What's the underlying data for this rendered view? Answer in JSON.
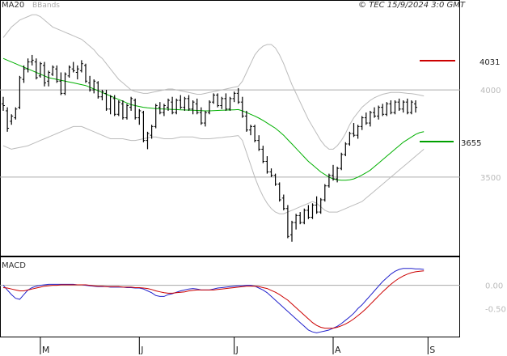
{
  "header": {
    "ma_label": "MA20",
    "bb_label": "BBands",
    "copyright": "© TEC 15/9/2024 3:0 GMT"
  },
  "macd_label": "MACD",
  "levels": {
    "resistance": "4031",
    "resistance_color": "#cc0000",
    "support": "3655",
    "support_color": "#00a000"
  },
  "colors": {
    "price": "#000000",
    "ma": "#00b000",
    "bbands": "#bbbbbb",
    "macd": "#2222cc",
    "signal": "#cc0000",
    "grid": "#aaaaaa"
  },
  "chart_data": [
    {
      "type": "bar",
      "title": "",
      "ylabel": "",
      "ylim": [
        3050,
        4450
      ],
      "ticks": [
        {
          "value": 4000,
          "label": "4000"
        },
        {
          "value": 3500,
          "label": "3500"
        }
      ],
      "gridlines": [
        4000,
        3500
      ],
      "x_labels": [
        {
          "index": 9,
          "label": "M"
        },
        {
          "index": 33,
          "label": "J"
        },
        {
          "index": 56,
          "label": "J"
        },
        {
          "index": 80,
          "label": "A"
        },
        {
          "index": 103,
          "label": "S"
        }
      ],
      "ohlc": [
        [
          3920,
          3960,
          3880,
          3910
        ],
        [
          3880,
          3900,
          3760,
          3780
        ],
        [
          3820,
          3860,
          3800,
          3850
        ],
        [
          3840,
          3900,
          3830,
          3890
        ],
        [
          3900,
          4080,
          3890,
          4070
        ],
        [
          4060,
          4140,
          4040,
          4120
        ],
        [
          4120,
          4180,
          4100,
          4160
        ],
        [
          4160,
          4200,
          4140,
          4170
        ],
        [
          4160,
          4180,
          4060,
          4070
        ],
        [
          4080,
          4160,
          4070,
          4150
        ],
        [
          4140,
          4160,
          4020,
          4040
        ],
        [
          4050,
          4110,
          4020,
          4100
        ],
        [
          4090,
          4140,
          4080,
          4130
        ],
        [
          4120,
          4140,
          4040,
          4050
        ],
        [
          4050,
          4100,
          3970,
          3980
        ],
        [
          3980,
          4100,
          3970,
          4090
        ],
        [
          4080,
          4140,
          4070,
          4130
        ],
        [
          4120,
          4160,
          4100,
          4110
        ],
        [
          4100,
          4140,
          4060,
          4120
        ],
        [
          4110,
          4170,
          4100,
          4150
        ],
        [
          4140,
          4150,
          4040,
          4050
        ],
        [
          4040,
          4080,
          3990,
          4000
        ],
        [
          4000,
          4060,
          3980,
          4050
        ],
        [
          4040,
          4050,
          3950,
          3960
        ],
        [
          3960,
          4000,
          3940,
          3990
        ],
        [
          3980,
          4000,
          3880,
          3890
        ],
        [
          3890,
          3970,
          3860,
          3960
        ],
        [
          3950,
          3970,
          3850,
          3860
        ],
        [
          3860,
          3940,
          3850,
          3930
        ],
        [
          3920,
          3940,
          3830,
          3840
        ],
        [
          3840,
          3920,
          3830,
          3910
        ],
        [
          3900,
          3960,
          3880,
          3950
        ],
        [
          3940,
          3950,
          3830,
          3840
        ],
        [
          3840,
          3890,
          3800,
          3880
        ],
        [
          3870,
          3880,
          3700,
          3710
        ],
        [
          3710,
          3760,
          3660,
          3750
        ],
        [
          3740,
          3800,
          3720,
          3790
        ],
        [
          3790,
          3920,
          3780,
          3910
        ],
        [
          3900,
          3930,
          3860,
          3870
        ],
        [
          3870,
          3920,
          3850,
          3910
        ],
        [
          3900,
          3950,
          3880,
          3940
        ],
        [
          3930,
          3960,
          3860,
          3870
        ],
        [
          3870,
          3950,
          3860,
          3940
        ],
        [
          3940,
          3970,
          3890,
          3900
        ],
        [
          3900,
          3960,
          3880,
          3950
        ],
        [
          3950,
          3970,
          3880,
          3890
        ],
        [
          3890,
          3940,
          3860,
          3930
        ],
        [
          3920,
          3950,
          3860,
          3870
        ],
        [
          3870,
          3900,
          3800,
          3810
        ],
        [
          3810,
          3880,
          3790,
          3870
        ],
        [
          3870,
          3940,
          3860,
          3930
        ],
        [
          3930,
          3980,
          3920,
          3970
        ],
        [
          3970,
          3980,
          3900,
          3910
        ],
        [
          3910,
          3960,
          3890,
          3950
        ],
        [
          3950,
          3980,
          3880,
          3890
        ],
        [
          3890,
          3960,
          3880,
          3950
        ],
        [
          3950,
          3990,
          3930,
          3980
        ],
        [
          3980,
          4010,
          3920,
          3930
        ],
        [
          3930,
          3960,
          3840,
          3850
        ],
        [
          3850,
          3880,
          3760,
          3770
        ],
        [
          3770,
          3800,
          3740,
          3790
        ],
        [
          3790,
          3800,
          3700,
          3710
        ],
        [
          3710,
          3740,
          3650,
          3660
        ],
        [
          3660,
          3680,
          3580,
          3590
        ],
        [
          3590,
          3620,
          3520,
          3530
        ],
        [
          3530,
          3550,
          3500,
          3510
        ],
        [
          3510,
          3520,
          3450,
          3460
        ],
        [
          3460,
          3470,
          3360,
          3370
        ],
        [
          3380,
          3400,
          3310,
          3320
        ],
        [
          3320,
          3340,
          3150,
          3160
        ],
        [
          3170,
          3250,
          3130,
          3240
        ],
        [
          3240,
          3290,
          3200,
          3280
        ],
        [
          3280,
          3300,
          3230,
          3240
        ],
        [
          3240,
          3320,
          3230,
          3310
        ],
        [
          3310,
          3340,
          3260,
          3270
        ],
        [
          3270,
          3350,
          3260,
          3340
        ],
        [
          3340,
          3390,
          3290,
          3300
        ],
        [
          3300,
          3380,
          3290,
          3370
        ],
        [
          3370,
          3460,
          3360,
          3450
        ],
        [
          3450,
          3520,
          3440,
          3510
        ],
        [
          3510,
          3570,
          3480,
          3490
        ],
        [
          3490,
          3560,
          3470,
          3550
        ],
        [
          3550,
          3640,
          3540,
          3630
        ],
        [
          3630,
          3700,
          3620,
          3690
        ],
        [
          3690,
          3760,
          3680,
          3750
        ],
        [
          3750,
          3810,
          3730,
          3740
        ],
        [
          3740,
          3800,
          3720,
          3790
        ],
        [
          3790,
          3850,
          3770,
          3840
        ],
        [
          3840,
          3870,
          3800,
          3810
        ],
        [
          3810,
          3880,
          3790,
          3870
        ],
        [
          3870,
          3900,
          3840,
          3850
        ],
        [
          3850,
          3910,
          3830,
          3900
        ],
        [
          3900,
          3920,
          3850,
          3860
        ],
        [
          3860,
          3930,
          3850,
          3920
        ],
        [
          3920,
          3940,
          3860,
          3870
        ],
        [
          3870,
          3940,
          3860,
          3930
        ],
        [
          3930,
          3950,
          3880,
          3890
        ],
        [
          3890,
          3940,
          3870,
          3930
        ],
        [
          3930,
          3950,
          3860,
          3870
        ],
        [
          3870,
          3940,
          3860,
          3930
        ],
        [
          3920,
          3940,
          3870,
          3900
        ]
      ],
      "ma20": [
        4180,
        4170,
        4160,
        4150,
        4140,
        4130,
        4120,
        4110,
        4100,
        4090,
        4080,
        4070,
        4065,
        4060,
        4055,
        4050,
        4045,
        4040,
        4035,
        4030,
        4025,
        4015,
        4005,
        3995,
        3985,
        3975,
        3965,
        3955,
        3945,
        3935,
        3925,
        3915,
        3910,
        3905,
        3900,
        3897,
        3895,
        3893,
        3891,
        3890,
        3889,
        3888,
        3887,
        3886,
        3885,
        3884,
        3883,
        3882,
        3881,
        3880,
        3880,
        3881,
        3882,
        3883,
        3884,
        3885,
        3886,
        3887,
        3880,
        3870,
        3860,
        3850,
        3838,
        3825,
        3810,
        3795,
        3780,
        3760,
        3740,
        3715,
        3690,
        3665,
        3640,
        3615,
        3590,
        3570,
        3550,
        3530,
        3515,
        3500,
        3490,
        3485,
        3482,
        3482,
        3485,
        3490,
        3500,
        3512,
        3525,
        3540,
        3560,
        3580,
        3600,
        3620,
        3640,
        3660,
        3680,
        3700,
        3715,
        3730,
        3745,
        3755,
        3760
      ],
      "bb_upper": [
        4300,
        4330,
        4360,
        4380,
        4400,
        4410,
        4420,
        4430,
        4430,
        4420,
        4400,
        4380,
        4360,
        4350,
        4340,
        4330,
        4320,
        4310,
        4300,
        4290,
        4270,
        4250,
        4230,
        4200,
        4180,
        4150,
        4120,
        4090,
        4060,
        4040,
        4020,
        4000,
        3990,
        3985,
        3980,
        3980,
        3985,
        3990,
        3995,
        4000,
        4005,
        4005,
        4000,
        3995,
        3990,
        3985,
        3980,
        3975,
        3975,
        3980,
        3985,
        3990,
        3995,
        4000,
        4005,
        4010,
        4015,
        4020,
        4050,
        4100,
        4150,
        4200,
        4230,
        4250,
        4260,
        4260,
        4240,
        4200,
        4150,
        4090,
        4030,
        3980,
        3930,
        3880,
        3830,
        3790,
        3750,
        3710,
        3680,
        3660,
        3660,
        3680,
        3710,
        3750,
        3800,
        3840,
        3870,
        3900,
        3920,
        3940,
        3955,
        3965,
        3975,
        3980,
        3985,
        3985,
        3985,
        3983,
        3980,
        3978,
        3975,
        3970,
        3965
      ],
      "bb_lower": [
        3680,
        3670,
        3660,
        3665,
        3670,
        3675,
        3680,
        3690,
        3700,
        3710,
        3720,
        3730,
        3740,
        3750,
        3760,
        3770,
        3780,
        3790,
        3790,
        3790,
        3780,
        3770,
        3760,
        3750,
        3740,
        3730,
        3720,
        3720,
        3720,
        3720,
        3715,
        3710,
        3710,
        3715,
        3720,
        3725,
        3730,
        3730,
        3725,
        3720,
        3720,
        3720,
        3725,
        3730,
        3730,
        3730,
        3730,
        3725,
        3720,
        3720,
        3720,
        3722,
        3725,
        3727,
        3730,
        3732,
        3735,
        3738,
        3710,
        3640,
        3570,
        3500,
        3440,
        3390,
        3350,
        3320,
        3300,
        3290,
        3290,
        3300,
        3310,
        3320,
        3330,
        3340,
        3350,
        3360,
        3350,
        3330,
        3310,
        3300,
        3300,
        3300,
        3310,
        3320,
        3330,
        3340,
        3350,
        3360,
        3380,
        3400,
        3420,
        3440,
        3460,
        3480,
        3500,
        3520,
        3540,
        3560,
        3580,
        3600,
        3620,
        3640,
        3660
      ],
      "levels": [
        {
          "name": "4031",
          "value": 4031
        },
        {
          "name": "3655",
          "value": 3655
        }
      ]
    },
    {
      "type": "line",
      "title": "MACD",
      "ylim": [
        -110,
        60
      ],
      "ticks": [
        {
          "value": 0,
          "label": "0.00"
        },
        {
          "value": -50,
          "label": "-0.50"
        }
      ],
      "gridlines": [
        0
      ],
      "series": [
        {
          "values": [
            0,
            -10,
            -20,
            -28,
            -30,
            -20,
            -10,
            -5,
            -2,
            0,
            1,
            2,
            2,
            2,
            2,
            2,
            2,
            2,
            1,
            1,
            0,
            -1,
            -2,
            -3,
            -3,
            -3,
            -4,
            -4,
            -4,
            -4,
            -5,
            -5,
            -6,
            -6,
            -8,
            -12,
            -16,
            -22,
            -24,
            -24,
            -20,
            -18,
            -15,
            -12,
            -10,
            -8,
            -7,
            -8,
            -10,
            -10,
            -10,
            -8,
            -6,
            -5,
            -4,
            -3,
            -2,
            -1,
            -1,
            0,
            0,
            -2,
            -6,
            -10,
            -16,
            -24,
            -32,
            -40,
            -48,
            -56,
            -64,
            -72,
            -80,
            -88,
            -96,
            -100,
            -102,
            -100,
            -98,
            -96,
            -92,
            -88,
            -82,
            -75,
            -68,
            -60,
            -50,
            -42,
            -32,
            -22,
            -12,
            -2,
            8,
            16,
            24,
            30,
            34,
            36,
            36,
            36,
            35,
            35,
            34
          ]
        },
        {
          "values": [
            -5,
            -6,
            -8,
            -10,
            -12,
            -12,
            -10,
            -8,
            -6,
            -4,
            -2,
            -1,
            0,
            0,
            1,
            1,
            1,
            1,
            1,
            1,
            1,
            0,
            -1,
            -2,
            -2,
            -3,
            -3,
            -3,
            -3,
            -4,
            -4,
            -4,
            -5,
            -5,
            -6,
            -7,
            -9,
            -12,
            -14,
            -16,
            -17,
            -17,
            -16,
            -15,
            -14,
            -12,
            -11,
            -10,
            -10,
            -10,
            -10,
            -10,
            -9,
            -8,
            -7,
            -6,
            -5,
            -4,
            -3,
            -2,
            -2,
            -2,
            -3,
            -5,
            -7,
            -11,
            -15,
            -20,
            -26,
            -32,
            -40,
            -48,
            -56,
            -64,
            -72,
            -80,
            -86,
            -90,
            -92,
            -92,
            -92,
            -90,
            -87,
            -83,
            -78,
            -72,
            -65,
            -58,
            -50,
            -41,
            -32,
            -23,
            -14,
            -6,
            2,
            9,
            15,
            20,
            24,
            27,
            29,
            30,
            31
          ]
        }
      ]
    }
  ]
}
